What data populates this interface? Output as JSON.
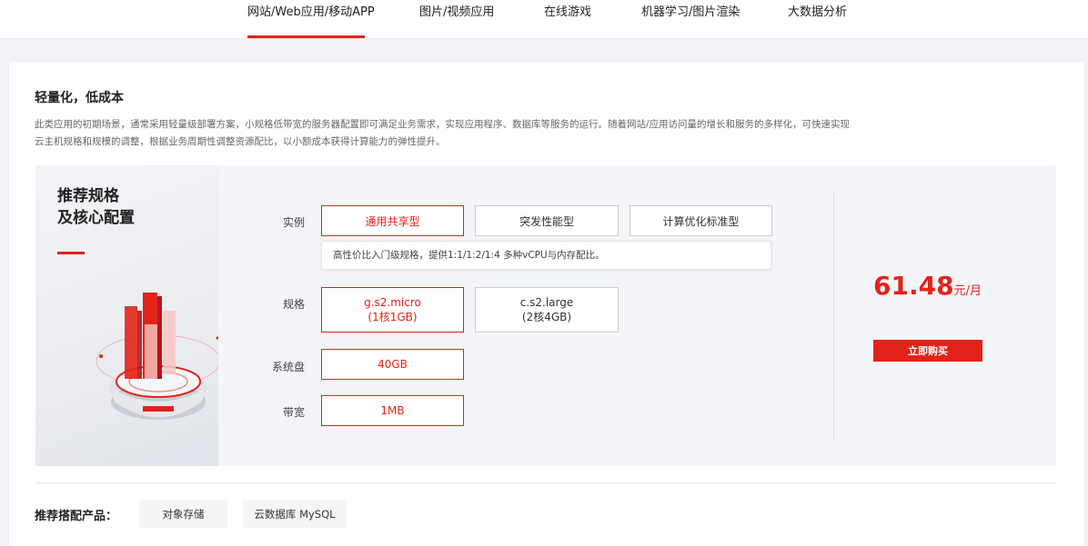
{
  "tabs": [
    {
      "label": "网站/Web应用/移动APP",
      "active": true
    },
    {
      "label": "图片/视频应用",
      "active": false
    },
    {
      "label": "在线游戏",
      "active": false
    },
    {
      "label": "机器学习/图片渲染",
      "active": false
    },
    {
      "label": "大数据分析",
      "active": false
    }
  ],
  "accent_color": "#e2231a",
  "section": {
    "title": "轻量化，低成本",
    "desc_line1": "此类应用的初期场景，通常采用轻量级部署方案，小规格低带宽的服务器配置即可满足业务需求，实现应用程序、数据库等服务的运行。随着网站/应用访问量的增长和服务的多样化，可快速实现",
    "desc_line2": "云主机规格和规模的调整，根据业务周期性调整资源配比，以小额成本获得计算能力的弹性提升。"
  },
  "visual": {
    "title_line1": "推荐规格",
    "title_line2": "及核心配置"
  },
  "config": {
    "instance_label": "实例",
    "instance_options": [
      "通用共享型",
      "突发性能型",
      "计算优化标准型"
    ],
    "instance_tip": "高性价比入门级规格，提供1:1/1:2/1:4 多种vCPU与内存配比。",
    "spec_label": "规格",
    "spec_options": [
      {
        "name": "g.s2.micro",
        "detail": "(1核1GB)"
      },
      {
        "name": "c.s2.large",
        "detail": "(2核4GB)"
      }
    ],
    "disk_label": "系统盘",
    "disk_value": "40GB",
    "bandwidth_label": "带宽",
    "bandwidth_value": "1MB"
  },
  "price": {
    "amount": "61.48",
    "unit": "元/月",
    "buy_label": "立即购买"
  },
  "recommend": {
    "label": "推荐搭配产品：",
    "items": [
      "对象存储",
      "云数据库 MySQL"
    ]
  }
}
